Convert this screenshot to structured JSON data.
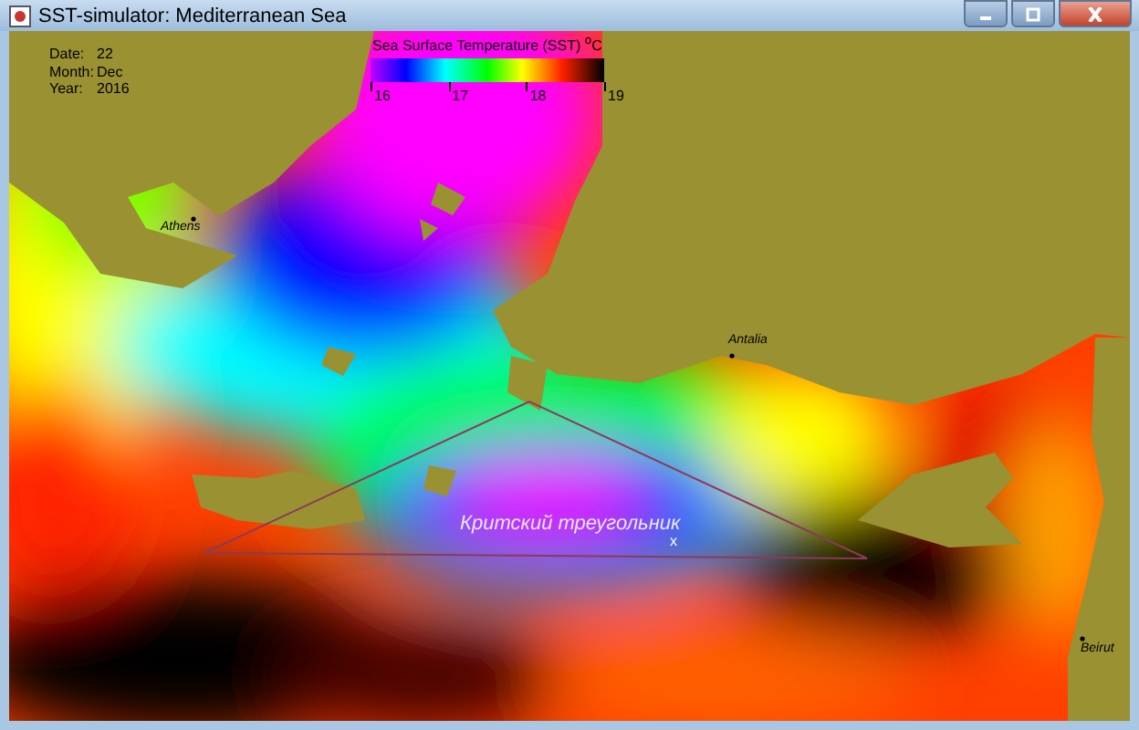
{
  "window": {
    "title": "SST-simulator: Mediterranean Sea"
  },
  "info": [
    {
      "label": "Date:",
      "value": "22"
    },
    {
      "label": "Month:",
      "value": "Dec"
    },
    {
      "label": "Year:",
      "value": "2016"
    }
  ],
  "legend": {
    "title": "Sea Surface Temperature  (SST) $^{o}$C",
    "ticks": [
      "16",
      "17",
      "18",
      "19"
    ]
  },
  "cities": [
    {
      "name": "Athens"
    },
    {
      "name": "Antalia"
    },
    {
      "name": "Beirut"
    }
  ],
  "annotation": {
    "label": "Критский треугольник",
    "marker": "x"
  }
}
